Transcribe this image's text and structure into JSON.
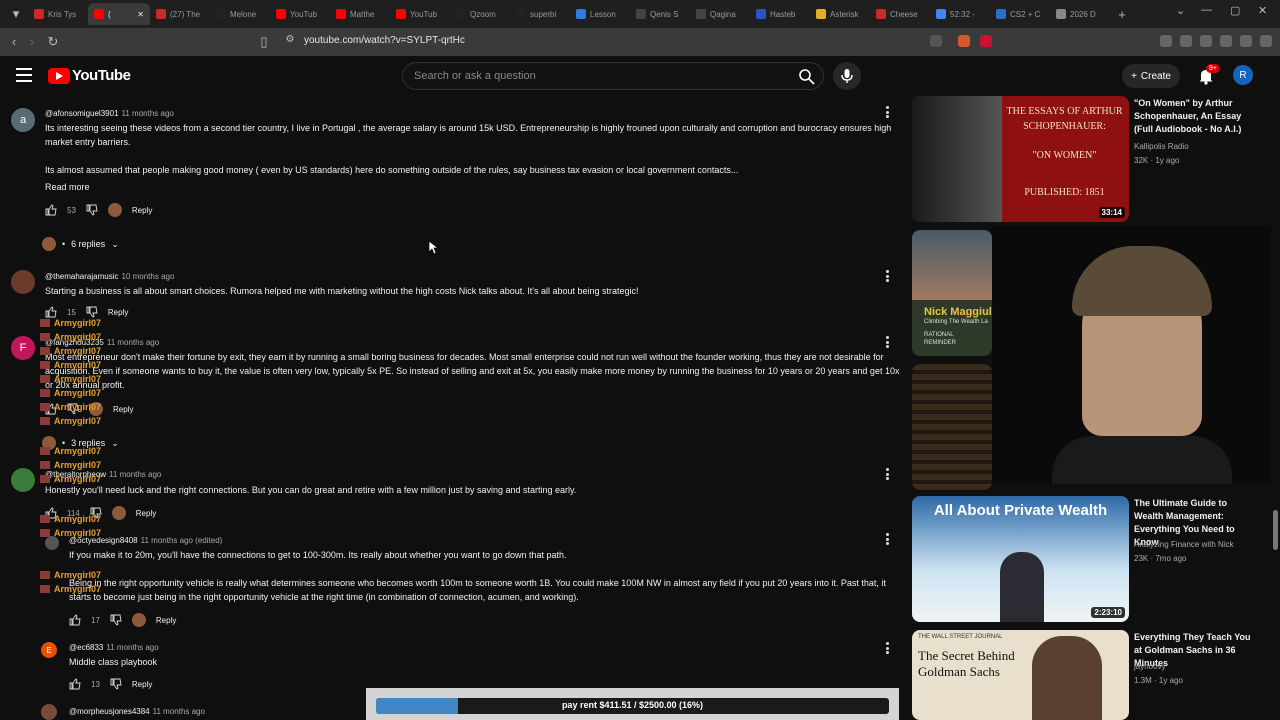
{
  "browser": {
    "tabs": [
      {
        "label": "Kris Tys",
        "color": "#cc2a2a"
      },
      {
        "label": "(",
        "color": "#ff0000",
        "active": true
      },
      {
        "label": "(27) The",
        "color": "#cc2a2a"
      },
      {
        "label": "Melone",
        "color": "#222222"
      },
      {
        "label": "YouTub",
        "color": "#ff0000"
      },
      {
        "label": "Matthe",
        "color": "#ff0000"
      },
      {
        "label": "YouTub",
        "color": "#ff0000"
      },
      {
        "label": "Qzoom",
        "color": "#222222"
      },
      {
        "label": "superbi",
        "color": "#222222"
      },
      {
        "label": "Lesson",
        "color": "#2d7be0"
      },
      {
        "label": "Qenis S",
        "color": "#444444"
      },
      {
        "label": "Qagina",
        "color": "#444444"
      },
      {
        "label": "Hasteb",
        "color": "#2855c2"
      },
      {
        "label": "Asterisk",
        "color": "#e0b020"
      },
      {
        "label": "Cheese",
        "color": "#cc2a2a"
      },
      {
        "label": "52:32 -",
        "color": "#4285f4"
      },
      {
        "label": "CS2 + C",
        "color": "#2a6fd0"
      },
      {
        "label": "2026 D",
        "color": "#888888"
      }
    ],
    "url": "youtube.com/watch?v=SYLPT-qrtHc"
  },
  "header": {
    "logo_text": "YouTube",
    "search_placeholder": "Search or ask a question",
    "create_label": "Create",
    "notif_badge": "9+",
    "avatar_letter": "R"
  },
  "comments": [
    {
      "avatar_letter": "a",
      "avatar_color": "#5a6b73",
      "handle": "@afonsomiguel3901",
      "time": "11 months ago",
      "text1": "Its interesting seeing these videos from a second tier country, I live in Portugal , the average salary is around 15k USD. Entrepreneurship is highly frouned upon culturally and corruption and burocracy ensures high market entry barriers.",
      "text2": "Its almost assumed that people making good money ( even by US standards) here do something outside of the rules, say business tax evasion or local government contacts...",
      "read_more": "Read more",
      "likes": "53",
      "reply": "Reply",
      "replies": "6 replies"
    },
    {
      "avatar_letter": "",
      "avatar_color": "#6b3a2a",
      "handle": "@themaharajamusic",
      "time": "10 months ago",
      "text1": "Starting a business is all about smart choices. Rumora helped me with marketing without the high costs Nick talks about. It's all about being strategic!",
      "likes": "15",
      "reply": "Reply"
    },
    {
      "avatar_letter": "F",
      "avatar_color": "#c2185b",
      "handle": "@fangzhou3235",
      "time": "11 months ago",
      "text1": "Most entrepreneur don't make their fortune by exit, they earn it by running a small boring business for decades. Most small enterprise could not run well without the founder working, thus they are not desirable for acquisition. Even if someone wants to buy it, the value is often very low, typically 5x PE. So instead of selling and exit at 5x, you easily make more money by running the business for 10 years or 20 years and get 10x or 20x annual profit.",
      "reply": "Reply",
      "replies": "3 replies"
    },
    {
      "avatar_letter": "",
      "avatar_color": "#3a7a3a",
      "handle": "@theraltorpheow",
      "time": "11 months ago",
      "text1": "Honestly you'll need luck and the right connections. But you can do great and retire with a few million just by saving and starting early.",
      "likes": "114",
      "reply": "Reply"
    },
    {
      "avatar_letter": "",
      "avatar_color": "#555555",
      "handle": "@octyedesign8408",
      "time": "11 months ago (edited)",
      "text1": "If you make it to 20m, you'll have the connections to get to 100-300m. Its really about whether you want to go down that path.",
      "text2": "Being in the right opportunity vehicle is really what determines someone who becomes worth 100m to someone worth 1B. You could make 100M NW in almost any field if you put 20 years into it. Past that, it starts to become just being in the right opportunity vehicle at the right time (in combination of connection, acumen, and working).",
      "likes": "17",
      "reply": "Reply"
    },
    {
      "avatar_letter": "E",
      "avatar_color": "#e65100",
      "handle": "@ec6833",
      "time": "11 months ago",
      "text1": "Middle class playbook",
      "likes": "13",
      "reply": "Reply"
    },
    {
      "avatar_letter": "",
      "avatar_color": "#7a4a3a",
      "handle": "@morpheusjones4384",
      "time": "11 months ago"
    }
  ],
  "overlay": {
    "name": "Armygirl07"
  },
  "sidebar": [
    {
      "title": "\"On Women\" by Arthur Schopenhauer, An Essay (Full Audiobook - No A.I.)",
      "channel": "Kallipolis Radio",
      "meta": "32K · 1y ago",
      "duration": "33:14",
      "thumb_lines": [
        "THE ESSAYS OF ARTHUR",
        "SCHOPENHAUER:",
        "\"ON WOMEN\"",
        "PUBLISHED: 1851"
      ],
      "thumb_bg": "#8e1010"
    },
    {
      "title": "",
      "channel": "",
      "meta": "",
      "duration": "",
      "thumb_lines": [
        "Nick Maggiul",
        "Climbing The Wealth La",
        "RATIONAL",
        "REMINDER"
      ],
      "thumb_bg": "#2d3a2a"
    },
    {
      "title": "",
      "channel": "",
      "meta": "",
      "duration": "",
      "thumb_lines": [],
      "thumb_bg": "#2a2018"
    },
    {
      "title": "The Ultimate Guide to Wealth Management: Everything You Need to Know",
      "channel": "Analyzing Finance with Nick",
      "meta": "23K · 7mo ago",
      "duration": "2:23:10",
      "thumb_lines": [
        "All About Private Wealth"
      ],
      "thumb_bg": "#1a4a7a"
    },
    {
      "title": "Everything They Teach You at Goldman Sachs in 36 Minutes",
      "channel": "jayhoovy",
      "meta": "1.3M · 1y ago",
      "duration": "",
      "thumb_lines": [
        "THE WALL STREET JOURNAL",
        "The Secret Behind",
        "Goldman Sachs"
      ],
      "thumb_bg": "#e8e0cc"
    }
  ],
  "progress": {
    "label": "pay rent $411.51 / $2500.00 (16%)",
    "fraction": 0.16
  }
}
